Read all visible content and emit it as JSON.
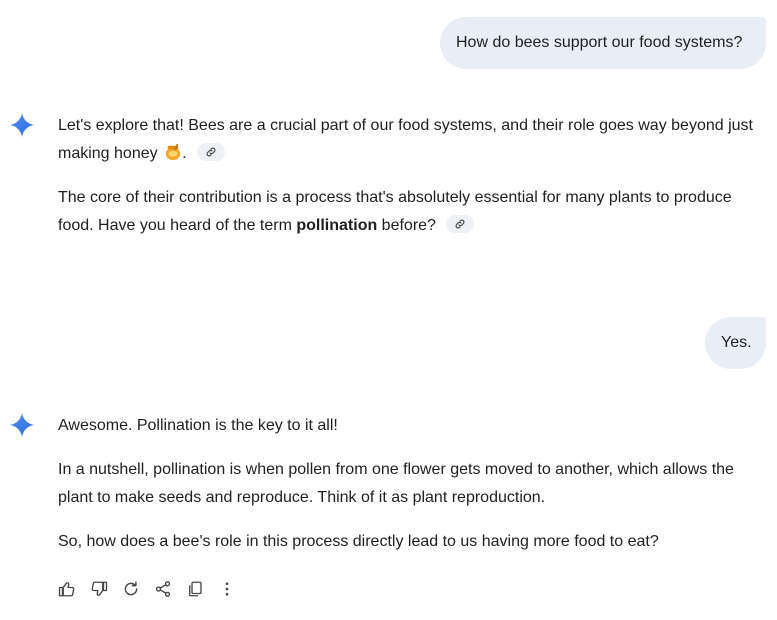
{
  "conversation": {
    "user_messages": [
      {
        "text": "How do bees support our food systems?"
      },
      {
        "text": "Yes."
      }
    ],
    "ai_messages": [
      {
        "paragraphs": [
          {
            "text_before": "Let's explore that! Bees are a crucial part of our food systems, and their role goes way beyond just making honey",
            "text_after": ".",
            "emoji": "honey-pot-icon"
          },
          {
            "text_before": "The core of their contribution is a process that's absolutely essential for many plants to produce food. Have you heard of the term ",
            "bold": "pollination",
            "text_after": " before?"
          }
        ]
      },
      {
        "paragraphs": [
          {
            "text": "Awesome. Pollination is the key to it all!"
          },
          {
            "text": "In a nutshell, pollination is when pollen from one flower gets moved to another, which allows the plant to make seeds and reproduce. Think of it as plant reproduction."
          },
          {
            "text": "So, how does a bee's role in this process directly lead to us having more food to eat?"
          }
        ]
      }
    ]
  },
  "icons": {
    "assistant": "gemini-spark-icon",
    "source_chip": "link-icon",
    "actions": [
      "thumbs-up-icon",
      "thumbs-down-icon",
      "regenerate-icon",
      "share-icon",
      "copy-icon",
      "more-vert-icon"
    ]
  },
  "colors": {
    "user_bubble": "#e9eef6",
    "text": "#1f1f1f",
    "icon": "#444746",
    "spark_start": "#4285f4",
    "spark_end": "#7aa7f7"
  }
}
